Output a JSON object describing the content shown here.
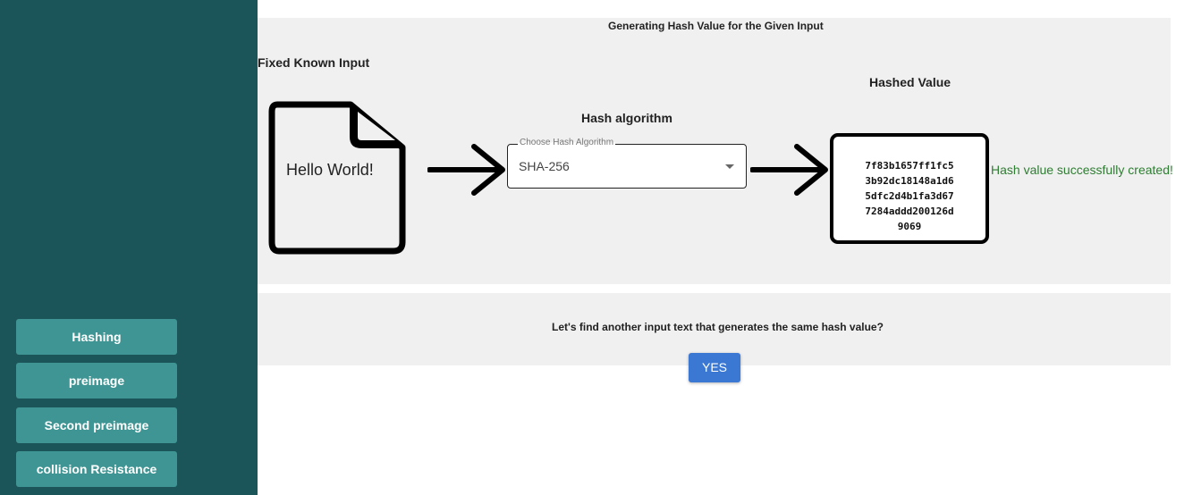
{
  "sidebar": {
    "items": [
      {
        "label": "Hashing"
      },
      {
        "label": "preimage"
      },
      {
        "label": "Second preimage"
      },
      {
        "label": "collision Resistance"
      }
    ]
  },
  "main": {
    "title": "Generating Hash Value for the Given Input",
    "input_heading": "Fixed Known Input",
    "input_text": "Hello World!",
    "algorithm_heading": "Hash algorithm",
    "algorithm_select": {
      "label": "Choose Hash Algorithm",
      "value": "SHA-256"
    },
    "hashed_heading": "Hashed Value",
    "hash_lines": [
      "7f83b1657ff1fc5",
      "3b92dc18148a1d6",
      "5dfc2d4b1fa3d67",
      "7284addd200126d",
      "9069"
    ],
    "success_message": "Hash value successfully created!"
  },
  "prompt": {
    "question": "Let's find another input text that generates the same hash value?",
    "yes_label": "YES"
  },
  "icons": {
    "document": "file-icon",
    "arrow": "arrow-right-icon",
    "dropdown": "caret-down-icon"
  },
  "colors": {
    "sidebar_bg": "#1c5559",
    "nav_button": "#3f9593",
    "panel_bg": "#f0f0f0",
    "yes_button": "#3a78d4",
    "success_text": "#2e7d32"
  }
}
